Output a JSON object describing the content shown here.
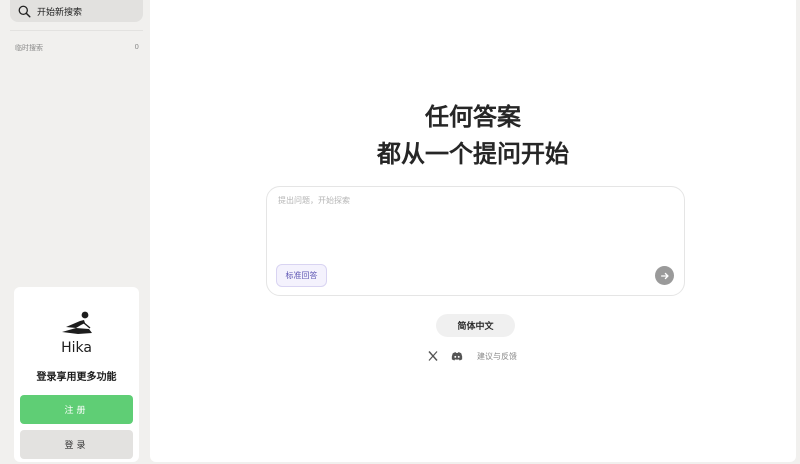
{
  "sidebar": {
    "new_search_label": "开始新搜索",
    "history_title": "临时搜索",
    "history_count": "0",
    "brand_name": "Hika",
    "login_prompt": "登录享用更多功能",
    "register_label": "注册",
    "login_label": "登录",
    "icons": [
      "search-icon",
      "hika-logo"
    ]
  },
  "main": {
    "headline_line1": "任何答案",
    "headline_line2": "都从一个提问开始",
    "search_placeholder": "提出问题，开始探索",
    "search_value": "",
    "mode_label": "标准回答",
    "language_label": "简体中文",
    "feedback_label": "建议与反馈",
    "icons": [
      "send-arrow-icon",
      "x-icon",
      "discord-icon"
    ]
  },
  "colors": {
    "register_green": "#5fce75",
    "mode_chip_text": "#5d55b3",
    "sidebar_bg": "#f1f0ee"
  }
}
